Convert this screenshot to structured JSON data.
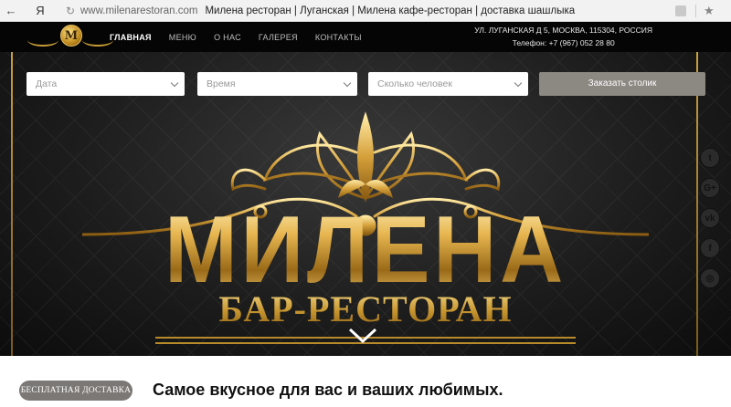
{
  "browser": {
    "back_icon": "←",
    "yandex_logo": "Я",
    "refresh_icon": "↻",
    "domain": "www.milenarestoran.com",
    "page_title": "Милена ресторан | Луганская | Милена кафе-ресторан | доставка шашлыка",
    "star_icon": "★"
  },
  "header": {
    "logo_letter": "M",
    "nav": [
      {
        "label": "ГЛАВНАЯ",
        "active": true
      },
      {
        "label": "МЕНЮ",
        "active": false
      },
      {
        "label": "О НАС",
        "active": false
      },
      {
        "label": "ГАЛЕРЕЯ",
        "active": false
      },
      {
        "label": "КОНТАКТЫ",
        "active": false
      }
    ],
    "address": "УЛ. ЛУГАНСКАЯ Д 5, МОСКВА, 115304, РОССИЯ",
    "phone": "Телефон: +7 (967) 052 28 80"
  },
  "booking": {
    "date": "Дата",
    "time": "Время",
    "guests": "Сколько человек",
    "submit": "Заказать столик"
  },
  "hero": {
    "title": "МИЛЕНА",
    "subtitle": "БАР-РЕСТОРАН"
  },
  "social": {
    "icons": [
      "twitter-icon",
      "google-plus-icon",
      "vk-icon",
      "facebook-icon",
      "instagram-icon"
    ],
    "labels": [
      "t",
      "G+",
      "vk",
      "f",
      "◎"
    ]
  },
  "promo": {
    "badge": "БЕСПЛАТНАЯ ДОСТАВКА",
    "tagline": "Самое вкусное для вас и ваших любимых."
  },
  "colors": {
    "gold": "#d9a945",
    "button_gray": "#8c8882",
    "badge_gray": "#7b7875"
  }
}
